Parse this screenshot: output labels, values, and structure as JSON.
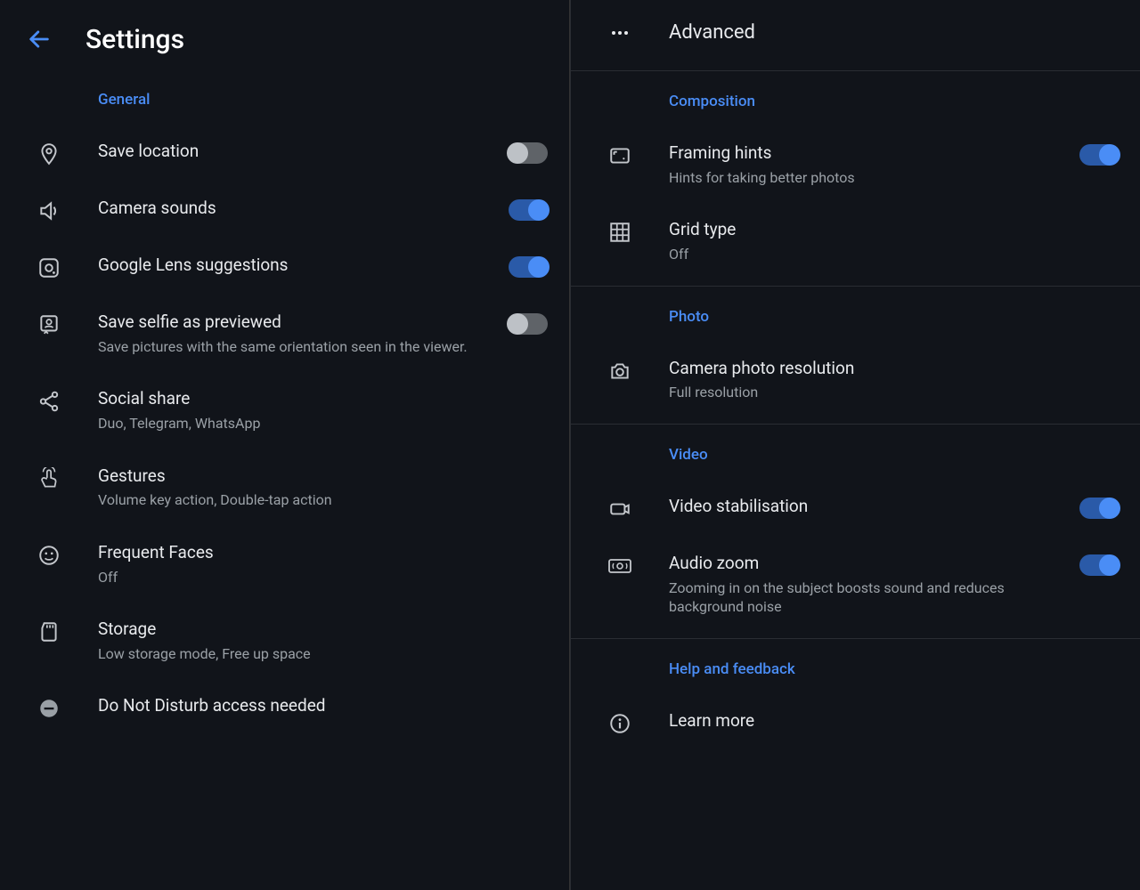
{
  "left": {
    "title": "Settings",
    "section_general": "General",
    "items": [
      {
        "label": "Save location",
        "sub": "",
        "toggle": "off"
      },
      {
        "label": "Camera sounds",
        "sub": "",
        "toggle": "on"
      },
      {
        "label": "Google Lens suggestions",
        "sub": "",
        "toggle": "on"
      },
      {
        "label": "Save selfie as previewed",
        "sub": "Save pictures with the same orientation seen in the viewer.",
        "toggle": "off"
      },
      {
        "label": "Social share",
        "sub": "Duo, Telegram, WhatsApp"
      },
      {
        "label": "Gestures",
        "sub": "Volume key action, Double-tap action"
      },
      {
        "label": "Frequent Faces",
        "sub": "Off"
      },
      {
        "label": "Storage",
        "sub": "Low storage mode, Free up space"
      },
      {
        "label": "Do Not Disturb access needed",
        "sub": ""
      }
    ]
  },
  "right": {
    "title": "Advanced",
    "section_composition": "Composition",
    "composition": [
      {
        "label": "Framing hints",
        "sub": "Hints for taking better photos",
        "toggle": "on"
      },
      {
        "label": "Grid type",
        "sub": "Off"
      }
    ],
    "section_photo": "Photo",
    "photo": [
      {
        "label": "Camera photo resolution",
        "sub": "Full resolution"
      }
    ],
    "section_video": "Video",
    "video": [
      {
        "label": "Video stabilisation",
        "sub": "",
        "toggle": "on"
      },
      {
        "label": "Audio zoom",
        "sub": "Zooming in on the subject boosts sound and reduces background noise",
        "toggle": "on"
      }
    ],
    "section_help": "Help and feedback",
    "help": [
      {
        "label": "Learn more",
        "sub": ""
      }
    ]
  }
}
